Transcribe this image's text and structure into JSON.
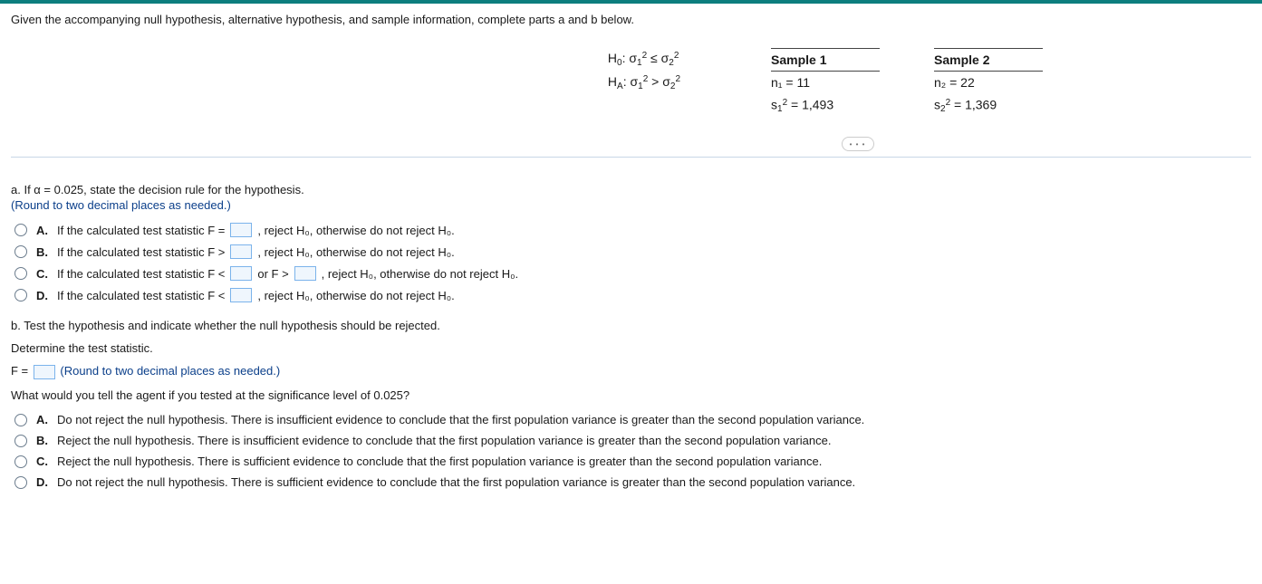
{
  "intro": "Given the accompanying null hypothesis, alternative hypothesis, and sample information, complete parts a and b below.",
  "hypo": {
    "h0_label": "H",
    "h0_sub": "0",
    "h0_colon": ": ",
    "sigma1_sq_leq": "σ",
    "one": "1",
    "two": "2",
    "leq": " ≤ ",
    "h0_rhs": "σ",
    "ha_label": "H",
    "ha_sub": "A",
    "gt": " > "
  },
  "tables": {
    "s1": {
      "header": "Sample 1",
      "r1": "n₁ = 11",
      "r2_left": "s",
      "r2_right": " = 1,493"
    },
    "s2": {
      "header": "Sample 2",
      "r1": "n₂ = 22",
      "r2_left": "s",
      "r2_right": " = 1,369"
    }
  },
  "parta": {
    "prompt": "a. If α = 0.025, state the decision rule for the hypothesis.",
    "note": "(Round to two decimal places as needed.)",
    "A": {
      "label": "A.",
      "pre": "If the calculated test statistic F =",
      "post": ", reject H₀, otherwise do not reject H₀."
    },
    "B": {
      "label": "B.",
      "pre": "If the calculated test statistic F >",
      "post": ", reject H₀, otherwise do not reject H₀."
    },
    "C": {
      "label": "C.",
      "pre": "If the calculated test statistic F <",
      "mid": "or F >",
      "post": ", reject H₀, otherwise do not reject H₀."
    },
    "D": {
      "label": "D.",
      "pre": "If the calculated test statistic F <",
      "post": ", reject H₀, otherwise do not reject H₀."
    }
  },
  "partb": {
    "prompt": "b. Test the hypothesis and indicate whether the null hypothesis should be rejected.",
    "det": "Determine the test statistic.",
    "feq": "F =",
    "note": "(Round to two decimal places as needed.)",
    "q": "What would you tell the agent if you tested at the significance level of 0.025?",
    "A": {
      "label": "A.",
      "text": "Do not reject the null hypothesis. There is insufficient evidence to conclude that the first population variance is greater than the second population variance."
    },
    "B": {
      "label": "B.",
      "text": "Reject the null hypothesis. There is insufficient evidence to conclude that the first population variance is greater than the second population variance."
    },
    "C": {
      "label": "C.",
      "text": "Reject the null hypothesis. There is sufficient evidence to conclude that the first population variance is greater than the second population variance."
    },
    "D": {
      "label": "D.",
      "text": "Do not reject the null hypothesis. There is sufficient evidence to conclude that the first population variance is greater than the second population variance."
    }
  },
  "ellipsis": "• • •"
}
